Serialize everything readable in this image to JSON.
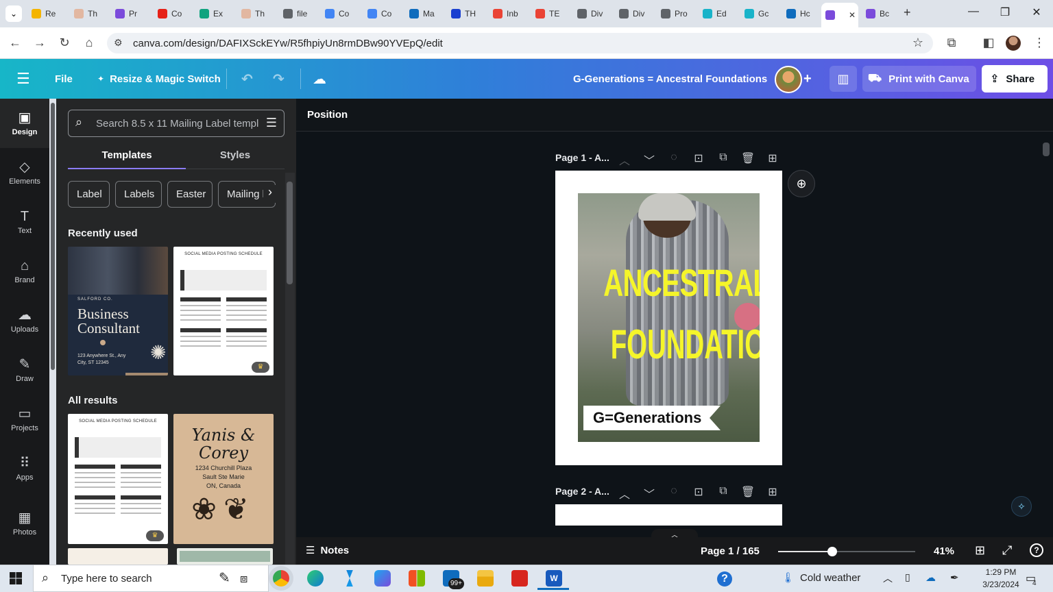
{
  "browser": {
    "tabs": [
      {
        "label": "Re",
        "color": "#f4b400"
      },
      {
        "label": "Th",
        "color": "#e2b7a1"
      },
      {
        "label": "Pr",
        "color": "#7b4bdb"
      },
      {
        "label": "Co",
        "color": "#e62117"
      },
      {
        "label": "Ex",
        "color": "#10a37f"
      },
      {
        "label": "Th",
        "color": "#e2b7a1"
      },
      {
        "label": "file",
        "color": "#5f6368"
      },
      {
        "label": "Co",
        "color": "#4285f4"
      },
      {
        "label": "Co",
        "color": "#4285f4"
      },
      {
        "label": "Ma",
        "color": "#0f6cbd"
      },
      {
        "label": "TH",
        "color": "#1a3fd0"
      },
      {
        "label": "Inb",
        "color": "#ea4335"
      },
      {
        "label": "TE",
        "color": "#ea4335"
      },
      {
        "label": "Div",
        "color": "#5f6368"
      },
      {
        "label": "Div",
        "color": "#5f6368"
      },
      {
        "label": "Pro",
        "color": "#5f6368"
      },
      {
        "label": "Ed",
        "color": "#19b3c9"
      },
      {
        "label": "Gc",
        "color": "#19b3c9"
      },
      {
        "label": "Hc",
        "color": "#0f6cbd"
      },
      {
        "label": "",
        "color": "#7b4bdb"
      },
      {
        "label": "Bc",
        "color": "#7b4bdb"
      }
    ],
    "url": "canva.com/design/DAFIXSckEYw/R5fhpiyUn8rmDBw90YVEpQ/edit"
  },
  "header": {
    "menu_icon": "hamburger-icon",
    "file_label": "File",
    "resize_label": "Resize & Magic Switch",
    "design_title": "G-Generations = Ancestral Foundations",
    "print_label": "Print with Canva",
    "share_label": "Share"
  },
  "rail": [
    {
      "label": "Design",
      "icon": "▣"
    },
    {
      "label": "Elements",
      "icon": "◇"
    },
    {
      "label": "Text",
      "icon": "T"
    },
    {
      "label": "Brand",
      "icon": "⌂"
    },
    {
      "label": "Uploads",
      "icon": "☁"
    },
    {
      "label": "Draw",
      "icon": "✎"
    },
    {
      "label": "Projects",
      "icon": "▭"
    },
    {
      "label": "Apps",
      "icon": "⠿"
    },
    {
      "label": "Photos",
      "icon": "▦"
    }
  ],
  "panel": {
    "search_placeholder": "Search 8.5 x 11 Mailing Label templ",
    "tab_templates": "Templates",
    "tab_styles": "Styles",
    "chips": [
      "Label",
      "Labels",
      "Easter",
      "Mailing la"
    ],
    "recently_used": "Recently used",
    "all_results": "All results",
    "t1": {
      "company": "SALFORD CO.",
      "title1": "Business",
      "title2": "Consultant",
      "addr1": "123 Anywhere St., Any",
      "addr2": "City, ST 12345"
    },
    "t2": {
      "title": "SOCIAL MEDIA POSTING SCHEDULE"
    },
    "t3": {
      "title": "SOCIAL MEDIA POSTING SCHEDULE"
    },
    "t4": {
      "name1": "Yanis &",
      "name2": "Corey",
      "addr1": "1234 Churchill Plaza",
      "addr2": "Sault Ste Marie",
      "addr3": "ON, Canada"
    }
  },
  "canvas": {
    "position_label": "Position",
    "page1_label": "Page 1 - A...",
    "page2_label": "Page 2 - A...",
    "headline1": "ANCESTRAL",
    "headline2": "FOUNDATIONS",
    "banner": "G=Generations"
  },
  "bottom": {
    "notes": "Notes",
    "page_indicator": "Page 1 / 165",
    "zoom": "41%",
    "zoom_fraction": 0.41
  },
  "taskbar": {
    "search_placeholder": "Type here to search",
    "weather": "Cold weather",
    "time": "1:29 PM",
    "date": "3/23/2024",
    "mail_badge": "99+",
    "notif_count": "4"
  }
}
